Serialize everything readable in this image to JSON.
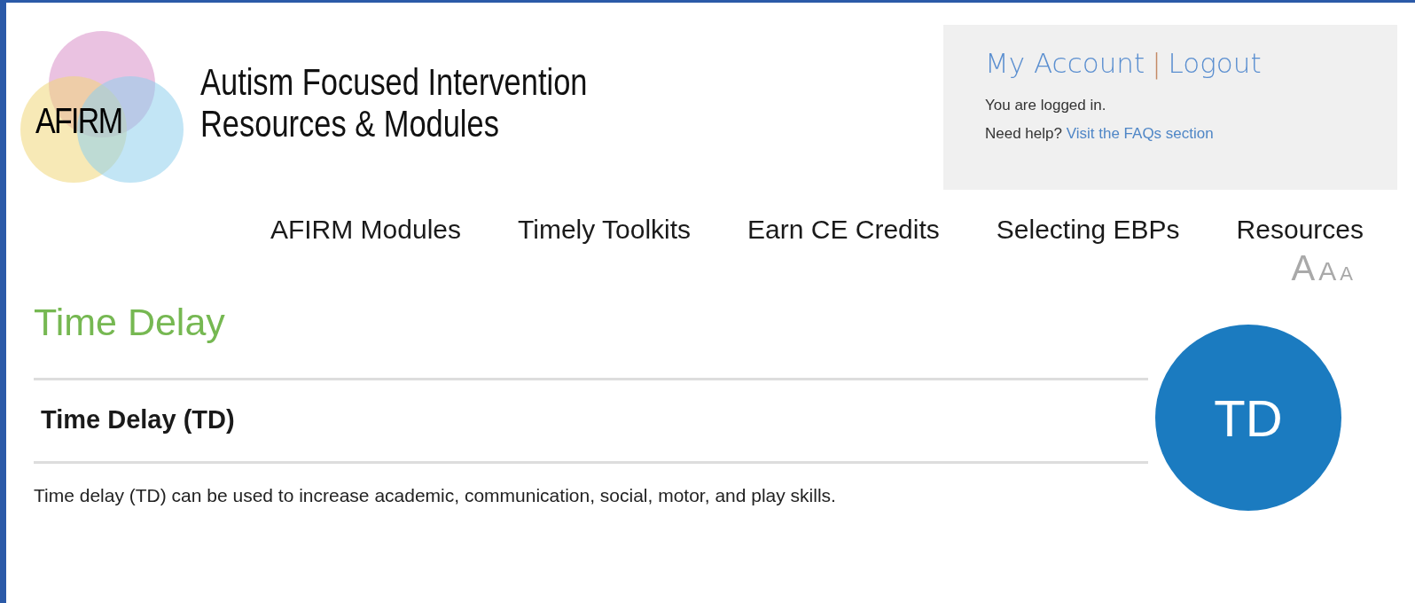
{
  "logo": {
    "text": "AFIRM",
    "title_lines": [
      "Autism Focused Intervention",
      "Resources & Modules"
    ]
  },
  "account": {
    "links": [
      "My Account",
      "Logout"
    ],
    "separator": "|",
    "status": "You are logged in.",
    "help_prefix": "Need help?",
    "help_link": "Visit the FAQs section"
  },
  "nav": [
    "AFIRM Modules",
    "Timely Toolkits",
    "Earn CE Credits",
    "Selecting EBPs",
    "Resources"
  ],
  "font_sizes": [
    "A",
    "A",
    "A"
  ],
  "page_title": "Time Delay",
  "section": {
    "heading": "Time Delay (TD)",
    "badge": "TD",
    "description": "Time delay (TD) can be used to increase academic, communication, social, motor, and play skills."
  }
}
